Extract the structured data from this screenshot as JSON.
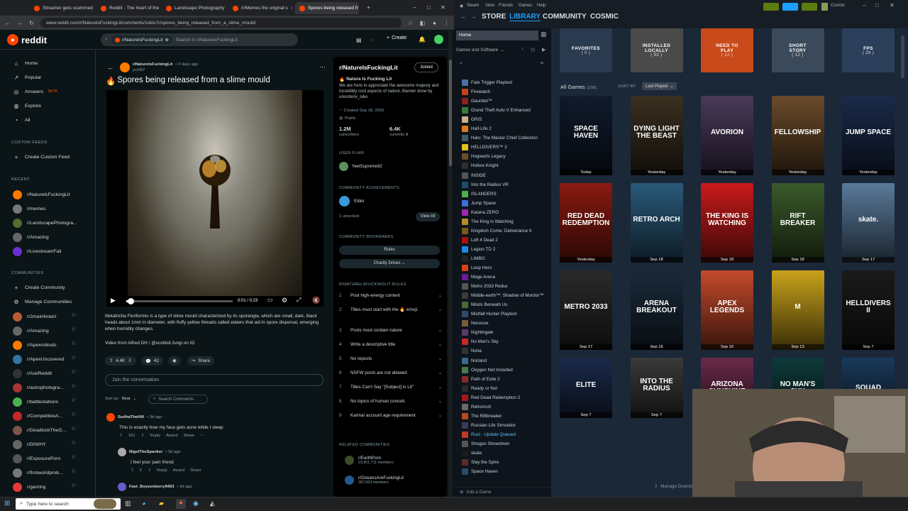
{
  "browser": {
    "tabs": [
      {
        "title": "Streamer gets scammed"
      },
      {
        "title": "Reddit - The heart of the"
      },
      {
        "title": "Landscape Photography"
      },
      {
        "title": "/r/Memes the original s"
      },
      {
        "title": "Spores being released fr",
        "active": true
      }
    ],
    "url": "www.reddit.com/r/NaturelsFuckingLit/comments/1nkio7r/spores_being_released_from_a_slime_mould/"
  },
  "reddit": {
    "logo": "reddit",
    "search": {
      "chip": "r/NaturelsFuckingLit",
      "placeholder": "Search in r/NaturelsFuckingLit"
    },
    "create": "Create",
    "nav": {
      "home": "Home",
      "popular": "Popular",
      "answers": "Answers",
      "beta": "BETA",
      "explore": "Explore",
      "all": "All",
      "custom_feeds": "CUSTOM FEEDS",
      "create_custom_feed": "Create Custom Feed",
      "recent": "RECENT",
      "recent_items": [
        "r/NaturelsFuckingLit",
        "r/memes",
        "r/LandscapePhotogra...",
        "r/Amazing",
        "r/LivestreamFail"
      ],
      "communities": "COMMUNITIES",
      "create_community": "Create Community",
      "manage_communities": "Manage Communities",
      "community_items": [
        "r/2meirl4meirl",
        "r/Amazing",
        "r/Apexrollouts",
        "r/ApexUncovered",
        "r/AskReddit",
        "r/astrophotogra...",
        "r/battlestations",
        "r/CompetitiveA...",
        "r/DeadlockTheG...",
        "r/DIWHY",
        "r/ExposurePorn",
        "r/firstworldprob...",
        "r/gaming"
      ]
    },
    "post": {
      "subreddit": "r/NaturelsFuckingLit",
      "age": "• 3 days ago",
      "author": "ycr007",
      "title": "Spores being released from a slime mould",
      "video_time": "0:01 / 0:23",
      "progress": 0.04,
      "description": "Metatricha Floriformis is a type of slime mould characterized by its sporangia, which are small, dark, black heads about 1mm in diameter, with fluffy yellow threads called elaters that aid in spore dispersal, emerging when humidity changes.",
      "credit": "Video from Alfred DH / @scottish.fungi on IG",
      "votes": "4.4K",
      "comments": "42",
      "share": "Share",
      "join": "Join the conversation",
      "sort_label": "Sort by:",
      "sort_value": "Best",
      "search_comments": "Search Comments"
    },
    "comments": [
      {
        "user": "SudhaTheHill",
        "ago": "• 3d ago",
        "text": "This is exactly how my face gets acne while I sleep",
        "votes": "151",
        "reply": "Reply",
        "award": "Award",
        "share": "Share"
      },
      {
        "user": "NigelTheSpanker",
        "ago": "• 3d ago",
        "text": "I feel your pain friend",
        "votes": "5",
        "reply": "Reply",
        "award": "Award",
        "share": "Share"
      },
      {
        "user": "Fast_Boysenberry9493",
        "ago": "• 3d ago"
      }
    ],
    "sidebar": {
      "name": "r/NaturelsFuckingLit",
      "joined": "Joined",
      "tagline": "Nature Is Fucking Lit",
      "about": "We are here to appreciate the awesome majesty and incredibly cool aspects of nature. Banner done by u/esoterix_luke",
      "created": "Created Sep 18, 2016",
      "visibility": "Public",
      "members": "1.2M",
      "members_label": "subscribers",
      "online": "6.4K",
      "online_label": "currently lit",
      "user_flair": "USER FLAIR",
      "flair_user": "YeetSupreme92",
      "achievements": "COMMUNITY ACHIEVEMENTS",
      "achievement": "Elder",
      "unlocked": "1 unlocked",
      "view_all": "View All",
      "bookmarks": "COMMUNITY BOOKMARKS",
      "rules_btn": "Rules",
      "charity_btn": "Charity Drives",
      "rules_header": "R/NATURELSFUCKINGLIT RULES",
      "rules": [
        "Post high-energy content",
        "Titles must start with the 🔥 emoji.",
        "Posts must contain nature",
        "Write a descriptive title",
        "No reposts",
        "NSFW posts are not allowed",
        "Titles Can't Say \"[Subject] is Lit\"",
        "No topics of human conceit.",
        "Karma/ account age requirement"
      ],
      "related": "RELATED COMMUNITIES",
      "related_items": [
        {
          "name": "r/EarthPorn",
          "members": "23,601,711 members"
        },
        {
          "name": "r/OceansAreFuckingLit",
          "members": "367,563 members"
        }
      ]
    }
  },
  "taskbar": {
    "search": "Type here to search"
  },
  "steam": {
    "menu": [
      "Steam",
      "View",
      "Friends",
      "Games",
      "Help"
    ],
    "nav": [
      "STORE",
      "LIBRARY",
      "COMMUNITY",
      "COSMIC"
    ],
    "user": "Cosmic",
    "home": "Home",
    "filter": "Games and Software",
    "games": [
      "Fate Trigger Playtest",
      "Firewatch",
      "Gauntlet™",
      "Grand Theft Auto V Enhanced",
      "GRIS",
      "Half-Life 2",
      "Halo: The Master Chief Collection",
      "HELLDIVERS™ 2",
      "Hogwarts Legacy",
      "Hollow Knight",
      "INSIDE",
      "Into the Radius VR",
      "ISLANDERS",
      "Jump Space",
      "Katana ZERO",
      "The King Is Watching",
      "Kingdom Come: Deliverance II",
      "Left 4 Dead 2",
      "Legion TD 2",
      "LIMBO",
      "Loop Hero",
      "Mage Arena",
      "Metro 2033 Redux",
      "Middle-earth™: Shadow of Mordor™",
      "Minds Beneath Us",
      "Mistfall Hunter Playtest",
      "Necesse",
      "Nightingale",
      "No Man's Sky",
      "Noita",
      "Norland",
      "Oxygen Not Included",
      "Path of Exile 2",
      "Ready or Not",
      "Red Dead Redemption 2",
      "RetroArch",
      "The Riftbreaker",
      "Russian Life Simulator",
      "Rust - Update Queued",
      "Shogun Showdown",
      "skate.",
      "Slay the Spire",
      "Space Haven"
    ],
    "add_game": "Add a Game",
    "manage_downloads": "Manage Downloads",
    "collections": [
      {
        "name": "FAVORITES",
        "count": "( 0 )"
      },
      {
        "name": "INSTALLED LOCALLY",
        "count": "( 92 )"
      },
      {
        "name": "NEED TO PLAY",
        "count": "( 12 )"
      },
      {
        "name": "SHORT STORY",
        "count": "( 12 )"
      },
      {
        "name": "FPS",
        "count": "( 26 )"
      }
    ],
    "all_games": "All Games",
    "all_count": "(298)",
    "sort_by": "SORT BY",
    "sort_value": "Last Played",
    "covers": [
      {
        "title": "SPACE HAVEN",
        "date": "Today"
      },
      {
        "title": "DYING LIGHT THE BEAST",
        "date": "Yesterday"
      },
      {
        "title": "AVORION",
        "date": "Yesterday"
      },
      {
        "title": "FELLOWSHIP",
        "date": "Yesterday"
      },
      {
        "title": "JUMP SPACE",
        "date": "Yesterday"
      },
      {
        "title": "RED DEAD REDEMPTION",
        "date": "Yesterday"
      },
      {
        "title": "RETRO ARCH",
        "date": "Sep 18"
      },
      {
        "title": "THE KING IS WATCHING",
        "date": "Sep 18"
      },
      {
        "title": "RIFT BREAKER",
        "date": "Sep 18"
      },
      {
        "title": "skate.",
        "date": "Sep 17"
      },
      {
        "title": "METRO 2033",
        "date": "Sep 17"
      },
      {
        "title": "ARENA BREAKOUT",
        "date": "Sep 16"
      },
      {
        "title": "APEX LEGENDS",
        "date": "Sep 16"
      },
      {
        "title": "M",
        "date": "Sep 13"
      },
      {
        "title": "HELLDIVERS II",
        "date": "Sep 7"
      },
      {
        "title": "ELITE",
        "date": "Sep 7"
      },
      {
        "title": "INTO THE RADIUS",
        "date": "Sep 7"
      },
      {
        "title": "ARIZONA SUNSHINE",
        "date": ""
      },
      {
        "title": "NO MAN'S SKY",
        "date": ""
      },
      {
        "title": "SQUAD",
        "date": ""
      }
    ]
  }
}
